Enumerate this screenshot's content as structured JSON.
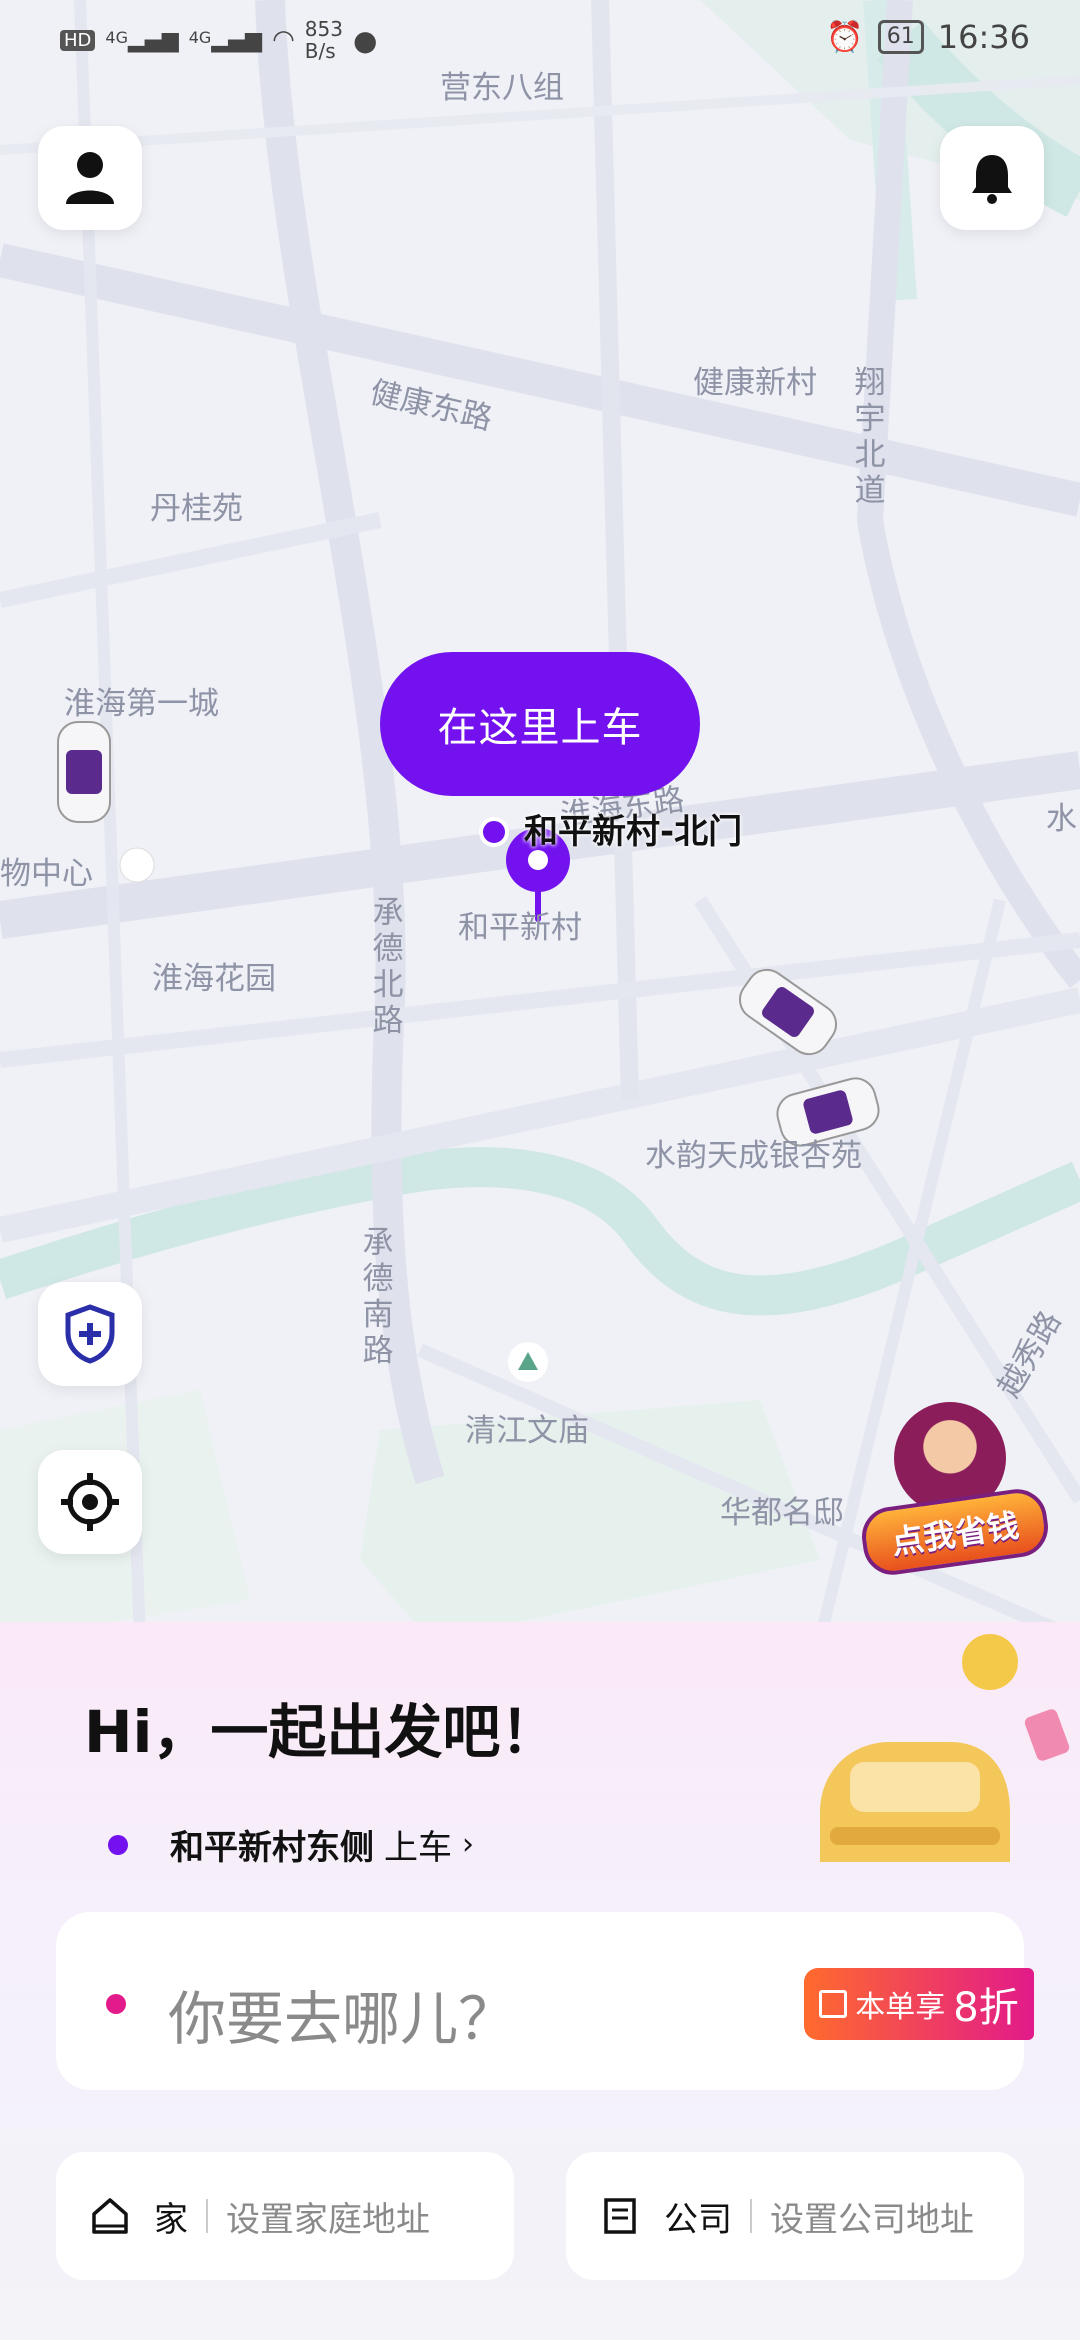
{
  "status_bar": {
    "hd": "HD",
    "net1": "4G",
    "net2": "4G",
    "speed_value": "853",
    "speed_unit": "B/s",
    "battery": "61",
    "time": "16:36"
  },
  "map": {
    "labels": {
      "yingdong": "营东八组",
      "jiankang_road": "健康东路",
      "jiankang_village": "健康新村",
      "xiangyu": "翔宇北道",
      "dangui": "丹桂苑",
      "huaihai_first": "淮海第一城",
      "shopping": "物中心",
      "huaihai_garden": "淮海花园",
      "chengde_north": "承德北路",
      "heping_village": "和平新村",
      "huaihai_road": "淮海东路",
      "shuiyun": "水韵天成银杏苑",
      "chengde_south": "承德南路",
      "qingjiang": "清江文庙",
      "huadu": "华都名邸",
      "yuexiu": "越秀路",
      "water": "水"
    },
    "pickup_bubble": "在这里上车",
    "pin_label": "和平新村-北门",
    "promo_badge_text": "点我省钱"
  },
  "panel": {
    "greeting": "Hi，一起出发吧！",
    "pickup_name": "和平新村东侧",
    "pickup_action": "上车",
    "destination_placeholder": "你要去哪儿？",
    "promo_label": "本单享",
    "promo_value": "8折",
    "home_label": "家",
    "home_hint": "设置家庭地址",
    "company_label": "公司",
    "company_hint": "设置公司地址"
  },
  "colors": {
    "accent": "#7312ef",
    "destination_dot": "#e21a8a"
  },
  "icons": [
    "profile-icon",
    "bell-icon",
    "shield-plus-icon",
    "locate-icon",
    "home-icon",
    "briefcase-icon"
  ]
}
